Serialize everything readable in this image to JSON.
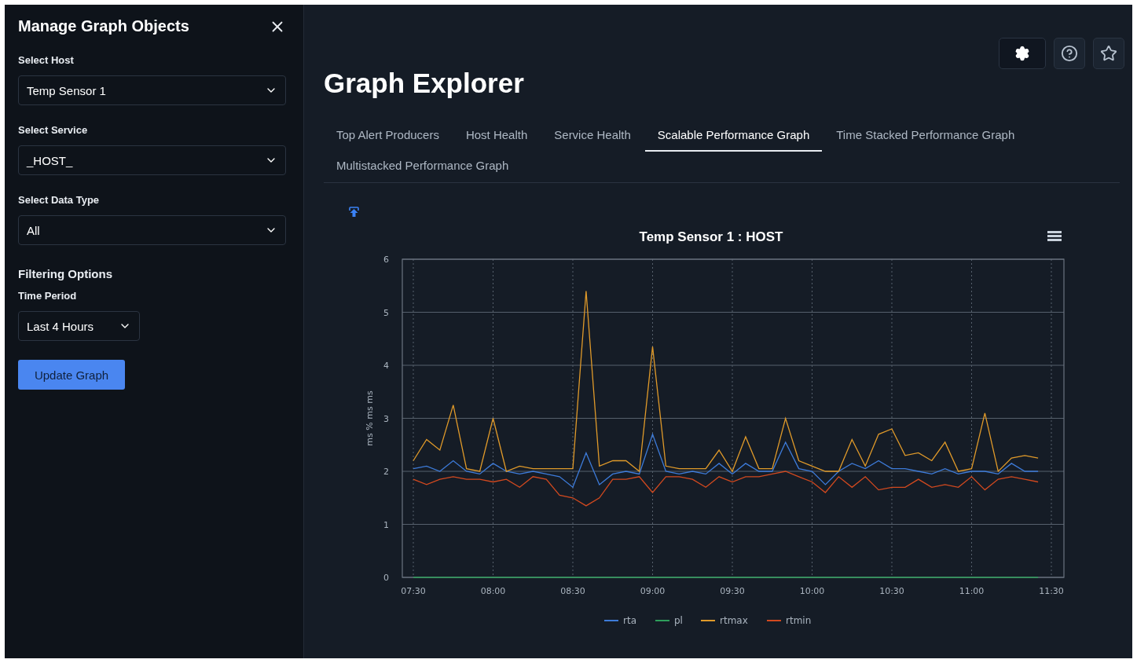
{
  "sidebar": {
    "title": "Manage Graph Objects",
    "fields": [
      {
        "label": "Select Host",
        "value": "Temp Sensor 1"
      },
      {
        "label": "Select Service",
        "value": "_HOST_"
      },
      {
        "label": "Select Data Type",
        "value": "All"
      }
    ],
    "filtering": {
      "heading": "Filtering Options",
      "label": "Time Period",
      "value": "Last 4 Hours"
    },
    "button": "Update Graph"
  },
  "main": {
    "title": "Graph Explorer",
    "tabs": [
      {
        "label": "Top Alert Producers",
        "selected": false
      },
      {
        "label": "Host Health",
        "selected": false
      },
      {
        "label": "Service Health",
        "selected": false
      },
      {
        "label": "Scalable Performance Graph",
        "selected": true
      },
      {
        "label": "Time Stacked Performance Graph",
        "selected": false
      },
      {
        "label": "Multistacked Performance Graph",
        "selected": false
      }
    ],
    "chart_data": {
      "type": "line",
      "title": "Temp Sensor 1 : HOST",
      "ylabel": "ms % ms ms",
      "categories": [
        "07:30",
        null,
        null,
        null,
        null,
        null,
        "08:00",
        null,
        null,
        null,
        null,
        null,
        "08:30",
        null,
        null,
        null,
        null,
        null,
        "09:00",
        null,
        null,
        null,
        null,
        null,
        "09:30",
        null,
        null,
        null,
        null,
        null,
        "10:00",
        null,
        null,
        null,
        null,
        null,
        "10:30",
        null,
        null,
        null,
        null,
        null,
        "11:00",
        null,
        null,
        null,
        null,
        null,
        "11:30"
      ],
      "series": [
        {
          "name": "rta",
          "color": "#3d7bd9",
          "values": [
            2.05,
            2.1,
            2.0,
            2.2,
            2.0,
            1.95,
            2.15,
            2.0,
            1.95,
            2.0,
            1.95,
            1.9,
            1.7,
            2.35,
            1.75,
            1.95,
            2.0,
            1.95,
            2.7,
            2.0,
            1.95,
            2.0,
            1.95,
            2.15,
            1.95,
            2.15,
            2.0,
            2.0,
            2.55,
            2.05,
            2.0,
            1.75,
            2.0,
            2.15,
            2.05,
            2.2,
            2.05,
            2.05,
            2.0,
            1.95,
            2.05,
            1.95,
            2.0,
            2.0,
            1.95,
            2.15,
            2.0,
            2.0,
            null
          ]
        },
        {
          "name": "pl",
          "color": "#2e9e5b",
          "values": [
            0,
            0,
            0,
            0,
            0,
            0,
            0,
            0,
            0,
            0,
            0,
            0,
            0,
            0,
            0,
            0,
            0,
            0,
            0,
            0,
            0,
            0,
            0,
            0,
            0,
            0,
            0,
            0,
            0,
            0,
            0,
            0,
            0,
            0,
            0,
            0,
            0,
            0,
            0,
            0,
            0,
            0,
            0,
            0,
            0,
            0,
            0,
            0,
            null
          ]
        },
        {
          "name": "rtmax",
          "color": "#e09a2a",
          "values": [
            2.2,
            2.6,
            2.4,
            3.25,
            2.05,
            2.0,
            3.0,
            2.0,
            2.1,
            2.05,
            2.05,
            2.05,
            2.05,
            5.4,
            2.1,
            2.2,
            2.2,
            2.0,
            4.35,
            2.1,
            2.05,
            2.05,
            2.05,
            2.4,
            2.0,
            2.65,
            2.05,
            2.05,
            3.0,
            2.2,
            2.1,
            2.0,
            2.0,
            2.6,
            2.1,
            2.7,
            2.8,
            2.3,
            2.35,
            2.2,
            2.55,
            2.0,
            2.05,
            3.1,
            2.0,
            2.25,
            2.3,
            2.25,
            null
          ]
        },
        {
          "name": "rtmin",
          "color": "#d2491f",
          "values": [
            1.85,
            1.75,
            1.85,
            1.9,
            1.85,
            1.85,
            1.8,
            1.85,
            1.7,
            1.9,
            1.85,
            1.55,
            1.5,
            1.35,
            1.5,
            1.85,
            1.85,
            1.9,
            1.6,
            1.9,
            1.9,
            1.85,
            1.7,
            1.9,
            1.8,
            1.9,
            1.9,
            1.95,
            2.0,
            1.9,
            1.8,
            1.6,
            1.9,
            1.7,
            1.9,
            1.65,
            1.7,
            1.7,
            1.85,
            1.7,
            1.75,
            1.7,
            1.9,
            1.65,
            1.85,
            1.9,
            1.85,
            1.8,
            null
          ]
        }
      ],
      "ylim": [
        0,
        6
      ],
      "grid": true,
      "legend": "bottom",
      "yticks": [
        0,
        1,
        2,
        3,
        4,
        5,
        6
      ]
    }
  }
}
